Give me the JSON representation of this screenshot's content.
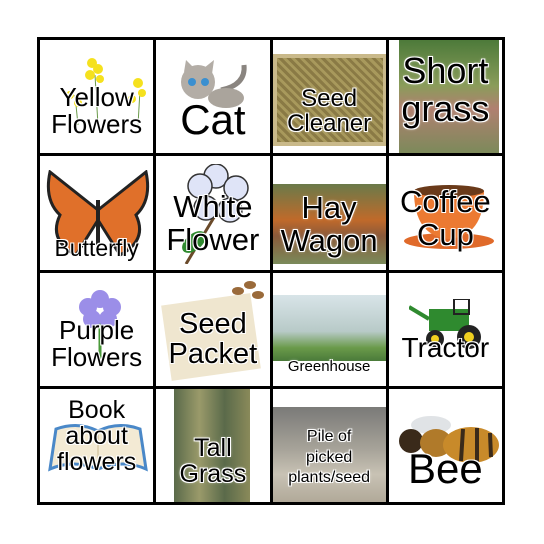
{
  "cells": [
    {
      "label": "Yellow\nFlowers",
      "image": "yellow-flowers-icon"
    },
    {
      "label": "Cat",
      "image": "cat-icon"
    },
    {
      "label": "Seed\nCleaner",
      "image": "seed-cleaner-photo"
    },
    {
      "label": "Short\ngrass",
      "image": "short-grass-photo"
    },
    {
      "label": "Butterfly",
      "image": "butterfly-icon"
    },
    {
      "label": "White\nFlower",
      "image": "white-flower-icon"
    },
    {
      "label": "Hay\nWagon",
      "image": "hay-wagon-photo"
    },
    {
      "label": "Coffee\nCup",
      "image": "coffee-cup-icon"
    },
    {
      "label": "Purple\nFlowers",
      "image": "purple-flower-icon"
    },
    {
      "label": "Seed\nPacket",
      "image": "seed-packet-icon"
    },
    {
      "label": "Greenhouse",
      "image": "greenhouse-photo"
    },
    {
      "label": "Tractor",
      "image": "tractor-icon"
    },
    {
      "label": "Book\nabout\nflowers",
      "image": "book-icon"
    },
    {
      "label": "Tall\nGrass",
      "image": "tall-grass-photo"
    },
    {
      "label": "Pile of\npicked\nplants/seed",
      "image": "seed-pile-photo"
    },
    {
      "label": "Bee",
      "image": "bee-icon"
    }
  ]
}
